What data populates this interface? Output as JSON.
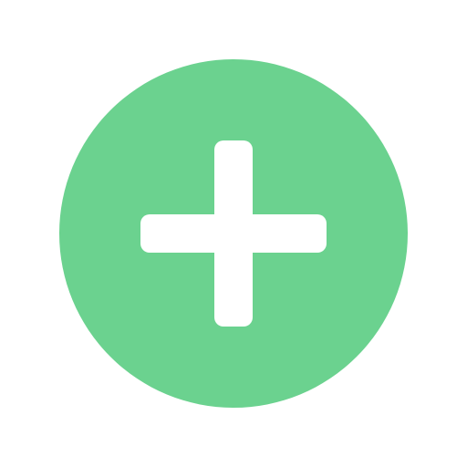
{
  "add_button": {
    "icon": "plus-icon",
    "label": ""
  },
  "colors": {
    "background": "#ffffff",
    "accent": "#6bd28f",
    "glyph": "#ffffff"
  }
}
